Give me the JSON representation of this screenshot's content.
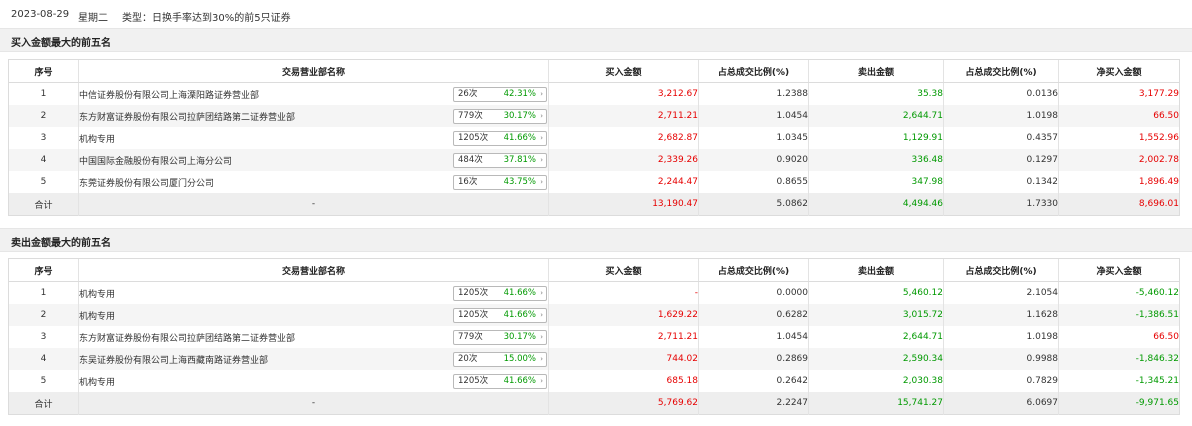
{
  "header": {
    "date": "2023-08-29",
    "weekday": "星期二",
    "type_text": "类型：日换手率达到30%的前5只证券"
  },
  "columns": [
    "序号",
    "交易营业部名称",
    "买入金额",
    "占总成交比例(%)",
    "卖出金额",
    "占总成交比例(%)",
    "净买入金额"
  ],
  "buy_section": {
    "title": "买入金额最大的前五名",
    "rows": [
      {
        "rank": "1",
        "name": "中信证券股份有限公司上海溧阳路证券营业部",
        "count": "26次",
        "rate": "42.31%",
        "buy": "3,212.67",
        "buy_pct": "1.2388",
        "sell": "35.38",
        "sell_pct": "0.0136",
        "net": "3,177.29",
        "net_sign": "red"
      },
      {
        "rank": "2",
        "name": "东方财富证券股份有限公司拉萨团结路第二证券营业部",
        "count": "779次",
        "rate": "30.17%",
        "buy": "2,711.21",
        "buy_pct": "1.0454",
        "sell": "2,644.71",
        "sell_pct": "1.0198",
        "net": "66.50",
        "net_sign": "red"
      },
      {
        "rank": "3",
        "name": "机构专用",
        "count": "1205次",
        "rate": "41.66%",
        "buy": "2,682.87",
        "buy_pct": "1.0345",
        "sell": "1,129.91",
        "sell_pct": "0.4357",
        "net": "1,552.96",
        "net_sign": "red"
      },
      {
        "rank": "4",
        "name": "中国国际金融股份有限公司上海分公司",
        "count": "484次",
        "rate": "37.81%",
        "buy": "2,339.26",
        "buy_pct": "0.9020",
        "sell": "336.48",
        "sell_pct": "0.1297",
        "net": "2,002.78",
        "net_sign": "red"
      },
      {
        "rank": "5",
        "name": "东莞证券股份有限公司厦门分公司",
        "count": "16次",
        "rate": "43.75%",
        "buy": "2,244.47",
        "buy_pct": "0.8655",
        "sell": "347.98",
        "sell_pct": "0.1342",
        "net": "1,896.49",
        "net_sign": "red"
      }
    ],
    "total": {
      "label": "合计",
      "name": "-",
      "buy": "13,190.47",
      "buy_pct": "5.0862",
      "sell": "4,494.46",
      "sell_pct": "1.7330",
      "net": "8,696.01",
      "net_sign": "red"
    }
  },
  "sell_section": {
    "title": "卖出金额最大的前五名",
    "rows": [
      {
        "rank": "1",
        "name": "机构专用",
        "count": "1205次",
        "rate": "41.66%",
        "buy": "-",
        "buy_pct": "0.0000",
        "sell": "5,460.12",
        "sell_pct": "2.1054",
        "net": "-5,460.12",
        "net_sign": "green"
      },
      {
        "rank": "2",
        "name": "机构专用",
        "count": "1205次",
        "rate": "41.66%",
        "buy": "1,629.22",
        "buy_pct": "0.6282",
        "sell": "3,015.72",
        "sell_pct": "1.1628",
        "net": "-1,386.51",
        "net_sign": "green"
      },
      {
        "rank": "3",
        "name": "东方财富证券股份有限公司拉萨团结路第二证券营业部",
        "count": "779次",
        "rate": "30.17%",
        "buy": "2,711.21",
        "buy_pct": "1.0454",
        "sell": "2,644.71",
        "sell_pct": "1.0198",
        "net": "66.50",
        "net_sign": "red"
      },
      {
        "rank": "4",
        "name": "东吴证券股份有限公司上海西藏南路证券营业部",
        "count": "20次",
        "rate": "15.00%",
        "buy": "744.02",
        "buy_pct": "0.2869",
        "sell": "2,590.34",
        "sell_pct": "0.9988",
        "net": "-1,846.32",
        "net_sign": "green"
      },
      {
        "rank": "5",
        "name": "机构专用",
        "count": "1205次",
        "rate": "41.66%",
        "buy": "685.18",
        "buy_pct": "0.2642",
        "sell": "2,030.38",
        "sell_pct": "0.7829",
        "net": "-1,345.21",
        "net_sign": "green"
      }
    ],
    "total": {
      "label": "合计",
      "name": "-",
      "buy": "5,769.62",
      "buy_pct": "2.2247",
      "sell": "15,741.27",
      "sell_pct": "6.0697",
      "net": "-9,971.65",
      "net_sign": "green"
    }
  },
  "colors": {
    "up": "#e60000",
    "down": "#009900",
    "header_bg": "#f1f1f1",
    "alt_row": "#f5f5f5"
  },
  "icons": {
    "badge_arrow": "chevron-right-icon"
  }
}
